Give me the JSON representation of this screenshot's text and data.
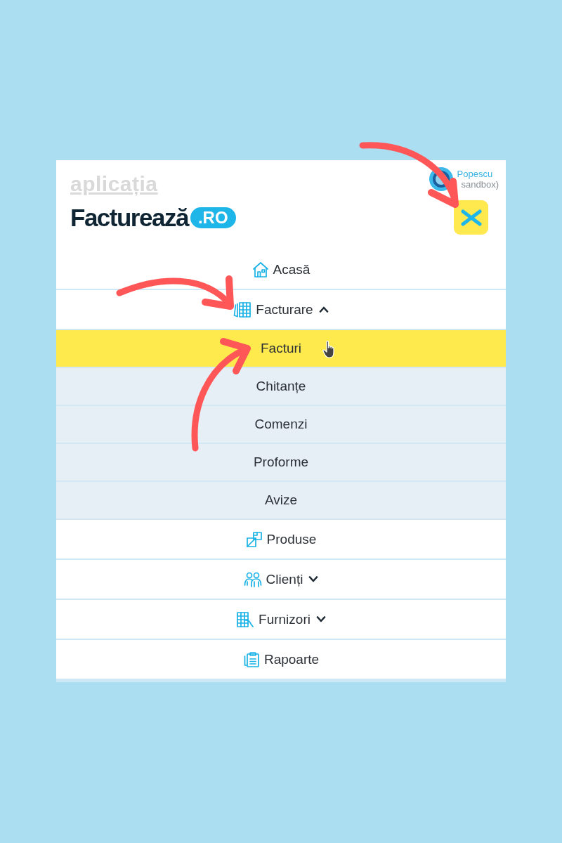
{
  "header": {
    "app_label": "aplicația",
    "logo": {
      "wordmark": "Facturează",
      "badge": ".RO"
    },
    "user": {
      "name": "Popescu",
      "account": "sandbox)"
    }
  },
  "menu": [
    {
      "kind": "link",
      "label": "Acasă"
    },
    {
      "kind": "group",
      "label": "Facturare",
      "expanded": true,
      "children": [
        {
          "label": "Facturi",
          "selected": true
        },
        {
          "label": "Chitanțe",
          "selected": false
        },
        {
          "label": "Comenzi",
          "selected": false
        },
        {
          "label": "Proforme",
          "selected": false
        },
        {
          "label": "Avize",
          "selected": false
        }
      ]
    },
    {
      "kind": "link",
      "label": "Produse"
    },
    {
      "kind": "group",
      "label": "Clienți",
      "expanded": false
    },
    {
      "kind": "group",
      "label": "Furnizori",
      "expanded": false
    },
    {
      "kind": "link",
      "label": "Rapoarte"
    }
  ]
}
